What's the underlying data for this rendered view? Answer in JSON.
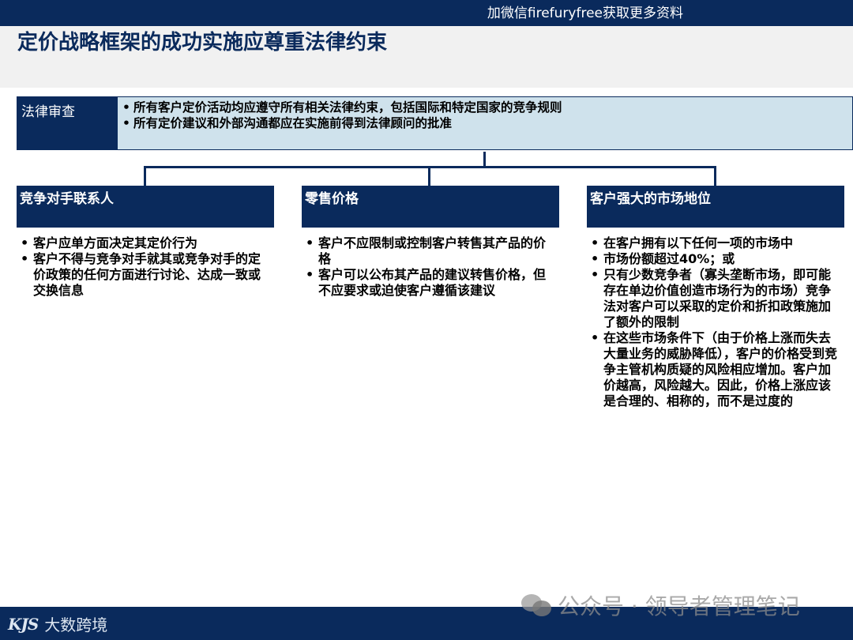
{
  "header": {
    "top_text": "加微信firefuryfree获取更多资料",
    "title": "定价战略框架的成功实施应尊重法律约束"
  },
  "legal": {
    "label": "法律审查",
    "items": [
      "所有客户定价活动均应遵守所有相关法律约束，包括国际和特定国家的竞争规则",
      "所有定价建议和外部沟通都应在实施前得到法律顾问的批准"
    ]
  },
  "columns": [
    {
      "title": "竞争对手联系人",
      "items": [
        "客户应单方面决定其定价行为",
        "客户不得与竞争对手就其或竞争对手的定价政策的任何方面进行讨论、达成一致或交换信息"
      ]
    },
    {
      "title": "零售价格",
      "items": [
        "客户不应限制或控制客户转售其产品的价格",
        "客户可以公布其产品的建议转售价格，但不应要求或迫使客户遵循该建议"
      ]
    },
    {
      "title": "客户强大的市场地位",
      "items": [
        "在客户拥有以下任何一项的市场中",
        "市场份额超过40%；或",
        "只有少数竞争者（寡头垄断市场，即可能存在单边价值创造市场行为的市场）竞争法对客户可以采取的定价和折扣政策施加了额外的限制",
        "在这些市场条件下（由于价格上涨而失去大量业务的威胁降低），客户的价格受到竞争主管机构质疑的风险相应增加。客户加价越高，风险越大。因此，价格上涨应该是合理的、相称的，而不是过度的"
      ]
    }
  ],
  "watermark": {
    "text": "公众号 · 领导者管理笔记",
    "icon": "wechat-icon"
  },
  "footer": {
    "brand_mark": "KJS",
    "brand_text": "大数跨境"
  },
  "colors": {
    "navy": "#0a2a5c",
    "light_blue": "#cfe2ec",
    "title_band": "#f1f1f1"
  }
}
